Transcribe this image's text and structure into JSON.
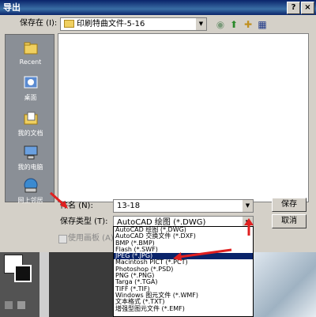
{
  "window": {
    "title": "导出",
    "help": "?",
    "close": "×"
  },
  "toolbar": {
    "save_in_label": "保存在 (I):",
    "current_folder": "印刷特曲文件-5-16"
  },
  "places": [
    {
      "label": "Recent",
      "icon": "recent-folder-icon"
    },
    {
      "label": "桌面",
      "icon": "desktop-icon"
    },
    {
      "label": "我的文档",
      "icon": "my-documents-icon"
    },
    {
      "label": "我的电脑",
      "icon": "my-computer-icon"
    },
    {
      "label": "网上邻居",
      "icon": "network-icon"
    }
  ],
  "form": {
    "filename_label": "件名 (N):",
    "filename_value": "13-18",
    "filetype_label": "保存类型 (T):",
    "filetype_value": "AutoCAD 绘图 (*.DWG)",
    "checkbox_label": "使用画板 (A)"
  },
  "buttons": {
    "save": "保存",
    "cancel": "取消"
  },
  "dropdown": {
    "items": [
      "AutoCAD 绘图 (*.DWG)",
      "AutoCAD 交换文件 (*.DXF)",
      "BMP (*.BMP)",
      "Flash (*.SWF)",
      "JPEG (*.JPG)",
      "Macintosh PICT (*.PCT)",
      "Photoshop (*.PSD)",
      "PNG (*.PNG)",
      "Targa (*.TGA)",
      "TIFF (*.TIF)",
      "Windows 图元文件 (*.WMF)",
      "文本格式 (*.TXT)",
      "增强型图元文件 (*.EMF)"
    ],
    "selected_index": 4
  },
  "colors": {
    "accent": "#0a246a",
    "annotation": "#e02020"
  }
}
